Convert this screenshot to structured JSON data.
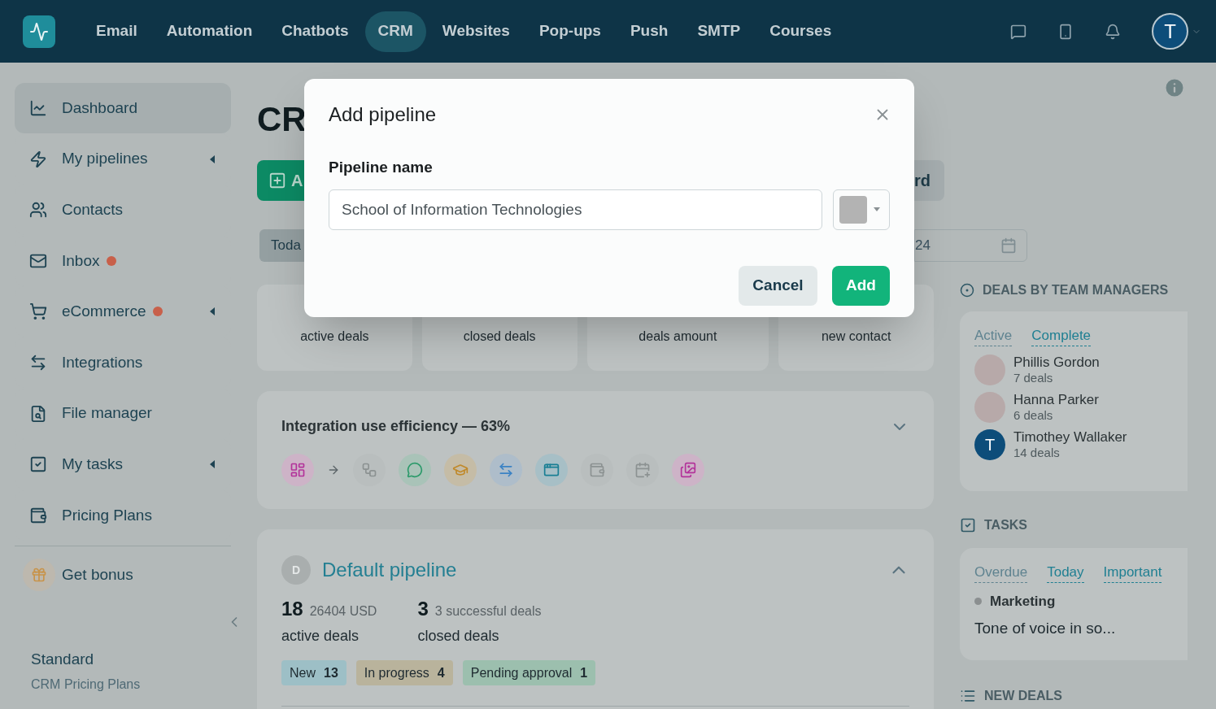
{
  "nav": {
    "items": [
      {
        "label": "Email",
        "selected": false
      },
      {
        "label": "Automation",
        "selected": false
      },
      {
        "label": "Chatbots",
        "selected": false
      },
      {
        "label": "CRM",
        "selected": true
      },
      {
        "label": "Websites",
        "selected": false
      },
      {
        "label": "Pop-ups",
        "selected": false
      },
      {
        "label": "Push",
        "selected": false
      },
      {
        "label": "SMTP",
        "selected": false
      },
      {
        "label": "Courses",
        "selected": false
      }
    ],
    "avatar_initial": "T"
  },
  "sidebar": {
    "items": [
      {
        "label": "Dashboard",
        "selected": true,
        "dot": false,
        "expandable": false
      },
      {
        "label": "My pipelines",
        "selected": false,
        "dot": false,
        "expandable": true
      },
      {
        "label": "Contacts",
        "selected": false,
        "dot": false,
        "expandable": false
      },
      {
        "label": "Inbox",
        "selected": false,
        "dot": true,
        "expandable": false
      },
      {
        "label": "eCommerce",
        "selected": false,
        "dot": true,
        "expandable": true
      },
      {
        "label": "Integrations",
        "selected": false,
        "dot": false,
        "expandable": false
      },
      {
        "label": "File manager",
        "selected": false,
        "dot": false,
        "expandable": false
      },
      {
        "label": "My tasks",
        "selected": false,
        "dot": false,
        "expandable": true
      },
      {
        "label": "Pricing Plans",
        "selected": false,
        "dot": false,
        "expandable": false
      }
    ],
    "bonus": "Get bonus",
    "plan": {
      "name": "Standard",
      "caption": "CRM Pricing Plans"
    }
  },
  "page": {
    "title": "CR",
    "add_button": "A",
    "right_button": "rd",
    "period_chip": "Toda",
    "date_field": "24"
  },
  "stats": [
    {
      "label": "active deals"
    },
    {
      "label": "closed deals"
    },
    {
      "label": "deals amount"
    },
    {
      "label": "new contact"
    }
  ],
  "integration": {
    "title": "Integration use efficiency — 63%"
  },
  "pipeline": {
    "initial": "D",
    "name": "Default pipeline",
    "active": {
      "count": "18",
      "amount": "26404 USD",
      "label": "active deals"
    },
    "closed": {
      "count": "3",
      "detail": "3 successful deals",
      "label": "closed deals"
    },
    "stages": [
      {
        "label": "New",
        "count": "13",
        "color": "#9dbfc6"
      },
      {
        "label": "In progress",
        "count": "4",
        "color": "#b9b39c"
      },
      {
        "label": "Pending approval",
        "count": "1",
        "color": "#9cbfae"
      }
    ]
  },
  "managers": {
    "title": "DEALS BY TEAM MANAGERS",
    "tabs": [
      {
        "label": "Active",
        "selected": true
      },
      {
        "label": "Complete",
        "selected": false
      }
    ],
    "people": [
      {
        "name": "Phillis Gordon",
        "deals": "7 deals",
        "kind": "photo"
      },
      {
        "name": "Hanna Parker",
        "deals": "6 deals",
        "kind": "photo"
      },
      {
        "name": "Timothey Wallaker",
        "deals": "14 deals",
        "kind": "initial",
        "initial": "T"
      }
    ]
  },
  "tasks": {
    "title": "TASKS",
    "tabs": [
      {
        "label": "Overdue",
        "selected": true
      },
      {
        "label": "Today",
        "selected": false
      },
      {
        "label": "Important",
        "selected": false
      }
    ],
    "items": [
      {
        "category": "Marketing",
        "text": "Tone of voice in so..."
      }
    ]
  },
  "new_deals": {
    "title": "NEW DEALS"
  },
  "dialog": {
    "title": "Add pipeline",
    "field_label": "Pipeline name",
    "value": "School of Information Technologies",
    "color": "#b3b3b3",
    "cancel": "Cancel",
    "confirm": "Add"
  }
}
